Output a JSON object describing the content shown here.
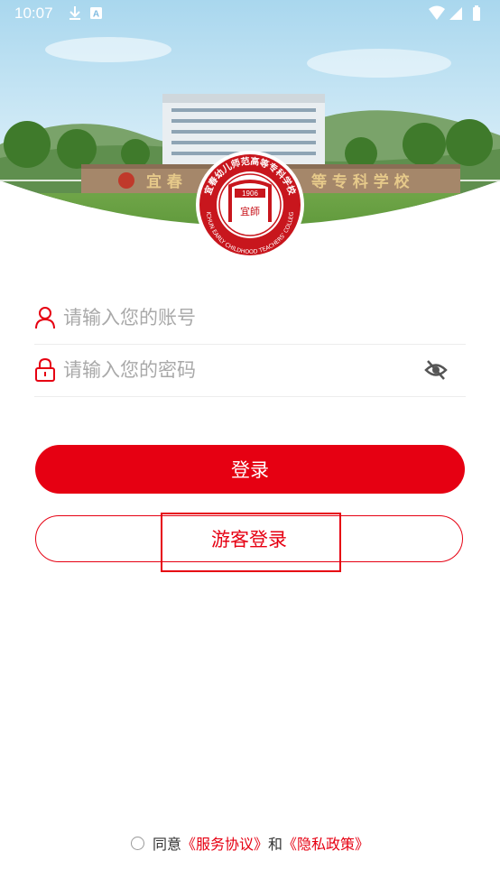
{
  "status_bar": {
    "time": "10:07",
    "left_icons": [
      "download-icon",
      "notification-a-icon"
    ],
    "right_icons": [
      "wifi-icon",
      "signal-icon",
      "battery-icon"
    ]
  },
  "banner": {
    "gate_text_left": "宜 春",
    "gate_text_right": "等 专 科 学 校",
    "logo": {
      "year": "1906",
      "arc_cn": "宜春幼儿师范高等专科学校",
      "arc_en": "YICHUN EARLY CHILDHOOD TEACHERS' COLLEGE",
      "center_glyph": "宜師"
    }
  },
  "login_form": {
    "account_placeholder": "请输入您的账号",
    "password_placeholder": "请输入您的密码",
    "login_button": "登录",
    "guest_login_button": "游客登录"
  },
  "agreement": {
    "prefix": "同意",
    "service_link": "《服务协议》",
    "joiner": "和",
    "privacy_link": "《隐私政策》"
  },
  "colors": {
    "brand_red": "#e60012",
    "placeholder": "#a9a9a9",
    "divider": "#ededed"
  }
}
